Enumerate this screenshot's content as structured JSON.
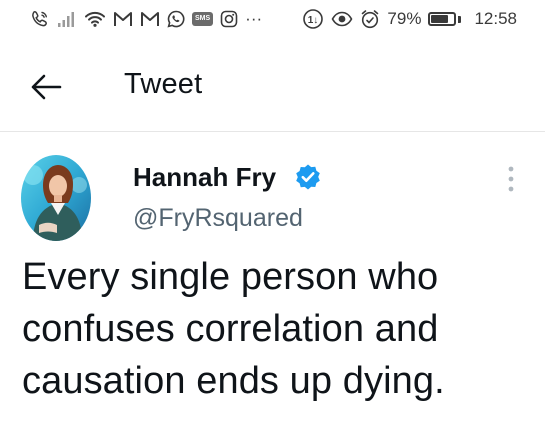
{
  "status_bar": {
    "left_icons": [
      "phone-call-icon",
      "signal-bars-icon",
      "wifi-icon",
      "gmail-icon",
      "gmail-icon",
      "whatsapp-icon",
      "sms-icon",
      "instagram-icon",
      "more-dots-icon"
    ],
    "sms_badge": "SMS",
    "overflow": "···",
    "right_icons": [
      "data-saver-icon",
      "eye-icon",
      "alarm-icon",
      "battery-icon"
    ],
    "battery_percent": "79%",
    "battery_level": 0.79,
    "time": "12:58"
  },
  "header": {
    "back_icon": "arrow-left-icon",
    "title": "Tweet"
  },
  "tweet": {
    "author_name": "Hannah Fry",
    "verified": true,
    "handle": "@FryRsquared",
    "text": "Every single person who\nconfuses correlation and\ncausation ends up dying.",
    "more_icon": "more-vertical-icon"
  },
  "colors": {
    "text_primary": "#0f1419",
    "text_secondary": "#536471",
    "verified_blue": "#1d9bf0",
    "divider": "#e6e6e6",
    "status_icons": "#3a3a3a"
  }
}
